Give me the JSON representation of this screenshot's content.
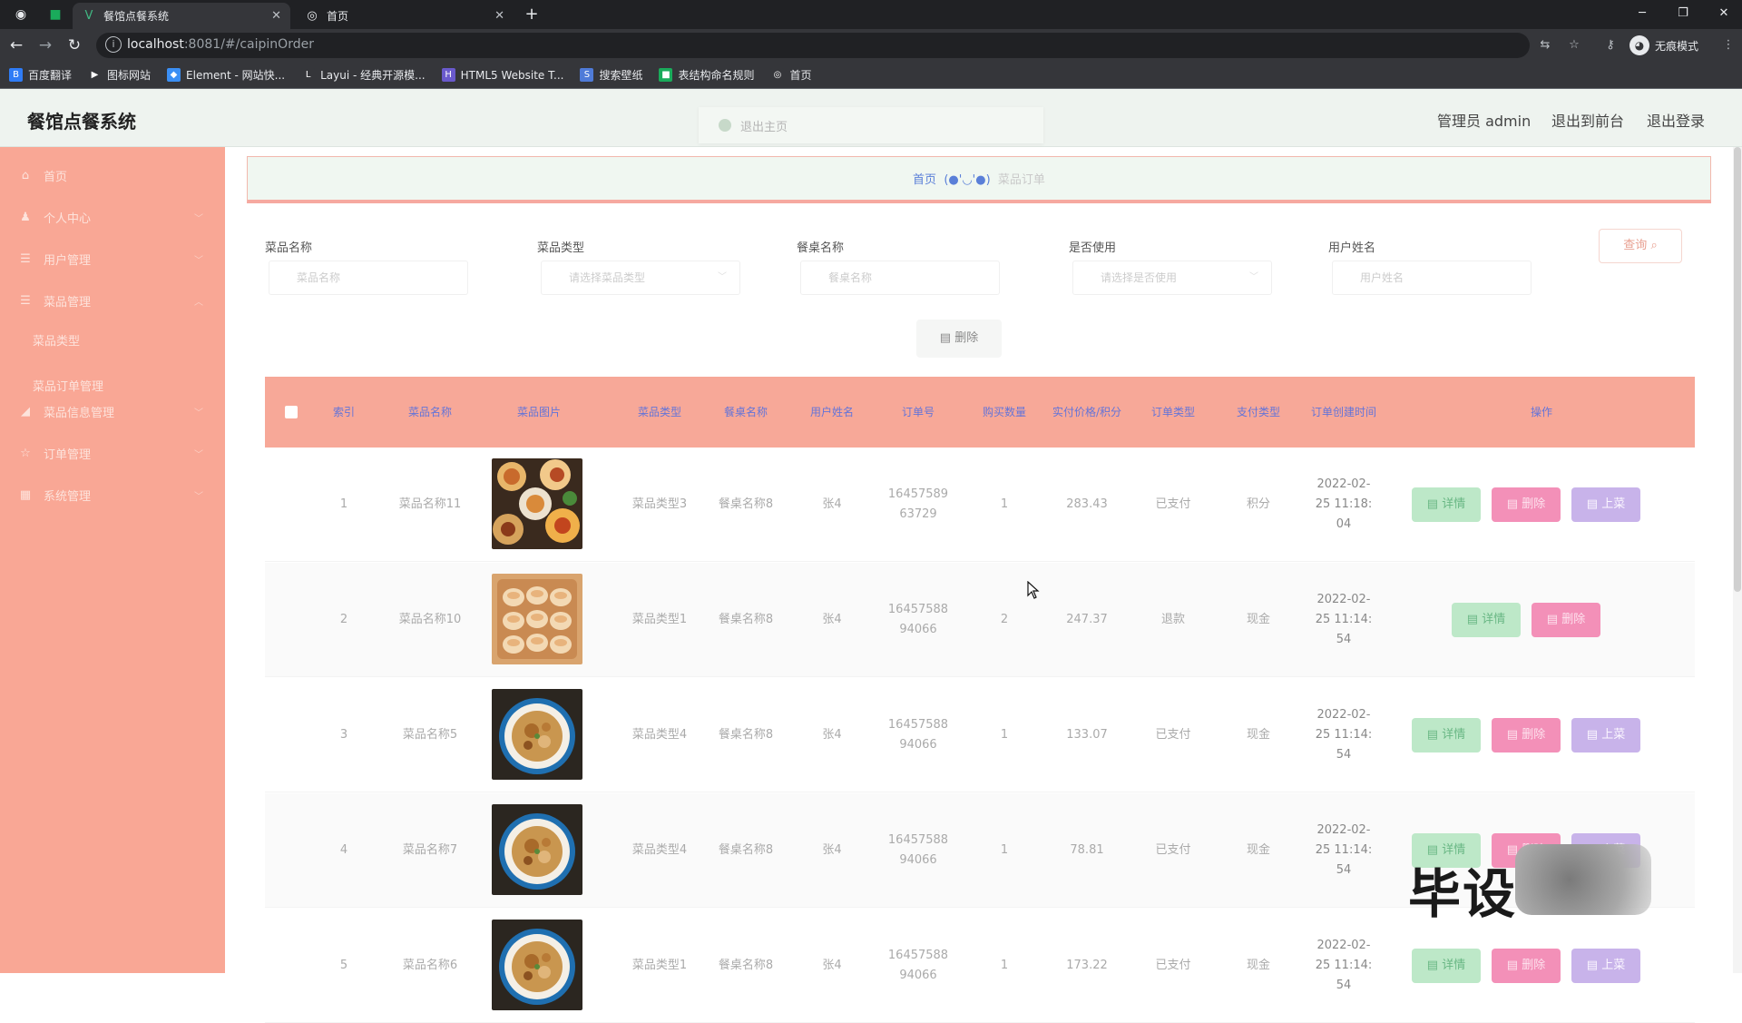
{
  "browser": {
    "tabs": [
      {
        "title": "餐馆点餐系统",
        "active": true
      },
      {
        "title": "首页",
        "active": false
      }
    ],
    "url": {
      "host": "localhost",
      "rest": ":8081/#/caipinOrder"
    },
    "profile_label": "无痕模式",
    "bookmarks": [
      {
        "label": "百度翻译",
        "color": "#2f7cf6",
        "icon": "B"
      },
      {
        "label": "图标网站",
        "color": "#35363a",
        "icon": "▶"
      },
      {
        "label": "Element - 网站快...",
        "color": "#3b8ff4",
        "icon": "◆"
      },
      {
        "label": "Layui - 经典开源模...",
        "color": "#35363a",
        "icon": "L"
      },
      {
        "label": "HTML5 Website T...",
        "color": "#6a5acd",
        "icon": "H"
      },
      {
        "label": "搜索壁纸",
        "color": "#4f7bd8",
        "icon": "S"
      },
      {
        "label": "表结构命名规则",
        "color": "#1aab5b",
        "icon": "■"
      },
      {
        "label": "首页",
        "color": "#35363a",
        "icon": "◎"
      }
    ]
  },
  "header": {
    "title": "餐馆点餐系统",
    "notice": "退出主页",
    "admin_label": "管理员 admin",
    "exit_front": "退出到前台",
    "logout": "退出登录"
  },
  "sidebar": {
    "items": [
      {
        "label": "首页",
        "icon": "home-icon",
        "glyph": "⌂"
      },
      {
        "label": "个人中心",
        "icon": "user-icon",
        "glyph": "♟"
      },
      {
        "label": "用户管理",
        "icon": "list-icon",
        "glyph": "☰"
      },
      {
        "label": "菜品管理",
        "icon": "list-icon",
        "glyph": "☰"
      },
      {
        "label": "菜品信息管理",
        "icon": "chart-icon",
        "glyph": "◢"
      },
      {
        "label": "订单管理",
        "icon": "user-icon",
        "glyph": "☆"
      },
      {
        "label": "系统管理",
        "icon": "grid-icon",
        "glyph": "▦"
      }
    ],
    "submenu": [
      "菜品类型",
      "菜品订单管理"
    ]
  },
  "breadcrumb": {
    "home": "首页",
    "sep": "(●'◡'●)",
    "current": "菜品订单"
  },
  "filters": {
    "labels": [
      "菜品名称",
      "菜品类型",
      "餐桌名称",
      "是否使用",
      "用户姓名"
    ],
    "placeholders": [
      "菜品名称",
      "请选择菜品类型",
      "餐桌名称",
      "请选择是否使用",
      "用户姓名"
    ],
    "search_button": "查询",
    "batch_delete": "删除"
  },
  "table": {
    "columns": [
      "索引",
      "菜品名称",
      "菜品图片",
      "菜品类型",
      "餐桌名称",
      "用户姓名",
      "订单号",
      "购买数量",
      "实付价格/积分",
      "订单类型",
      "支付类型",
      "订单创建时间",
      "操作"
    ],
    "buttons": {
      "detail": "详情",
      "delete": "删除",
      "up": "上菜"
    },
    "rows": [
      {
        "index": "1",
        "name": "菜品名称11",
        "type": "菜品类型3",
        "table": "餐桌名称8",
        "user": "张4",
        "order_no": "1645758963729",
        "qty": "1",
        "price": "283.43",
        "status": "已支付",
        "pay": "积分",
        "time": "2022-02-25 11:18:04",
        "show_up": true,
        "img": "plate-mixed"
      },
      {
        "index": "2",
        "name": "菜品名称10",
        "type": "菜品类型1",
        "table": "餐桌名称8",
        "user": "张4",
        "order_no": "1645758894066",
        "qty": "2",
        "price": "247.37",
        "status": "退款",
        "pay": "现金",
        "time": "2022-02-25 11:14:54",
        "show_up": false,
        "img": "dumplings"
      },
      {
        "index": "3",
        "name": "菜品名称5",
        "type": "菜品类型4",
        "table": "餐桌名称8",
        "user": "张4",
        "order_no": "1645758894066",
        "qty": "1",
        "price": "133.07",
        "status": "已支付",
        "pay": "现金",
        "time": "2022-02-25 11:14:54",
        "show_up": true,
        "img": "bowl"
      },
      {
        "index": "4",
        "name": "菜品名称7",
        "type": "菜品类型4",
        "table": "餐桌名称8",
        "user": "张4",
        "order_no": "1645758894066",
        "qty": "1",
        "price": "78.81",
        "status": "已支付",
        "pay": "现金",
        "time": "2022-02-25 11:14:54",
        "show_up": true,
        "img": "bowl"
      },
      {
        "index": "5",
        "name": "菜品名称6",
        "type": "菜品类型1",
        "table": "餐桌名称8",
        "user": "张4",
        "order_no": "1645758894066",
        "qty": "1",
        "price": "173.22",
        "status": "已支付",
        "pay": "现金",
        "time": "2022-02-25 11:14:54",
        "show_up": true,
        "img": "bowl"
      }
    ]
  },
  "watermark": "毕设"
}
